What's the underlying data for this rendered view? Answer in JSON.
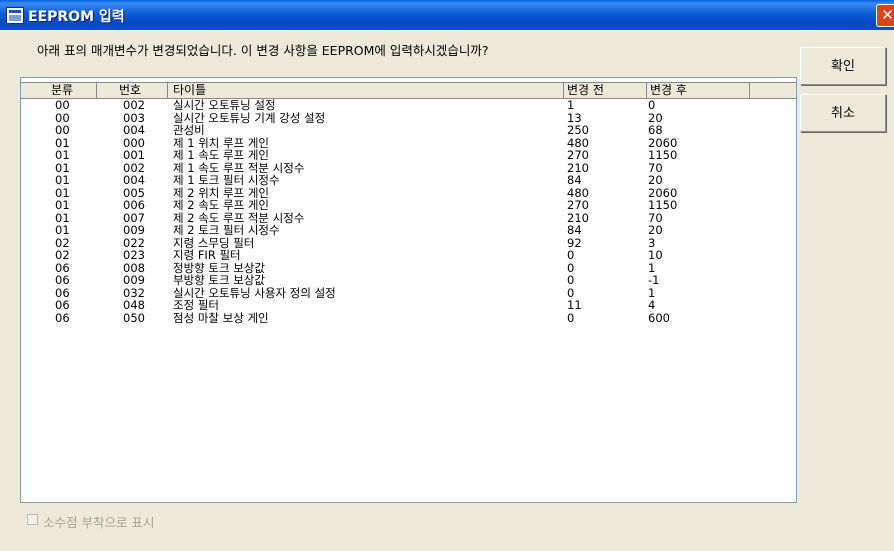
{
  "window": {
    "title": "EEPROM 입력",
    "close": "✕"
  },
  "message": "아래 표의 매개변수가 변경되었습니다. 이 변경 사항을 EEPROM에 입력하시겠습니까?",
  "buttons": {
    "ok": "확인",
    "cancel": "취소"
  },
  "table": {
    "headers": [
      "분류",
      "번호",
      "타이틀",
      "변경 전",
      "변경 후"
    ],
    "rows": [
      [
        "00",
        "002",
        "실시간 오토튜닝 설정",
        "1",
        "0"
      ],
      [
        "00",
        "003",
        "실시간 오토튜닝 기계 강성 설정",
        "13",
        "20"
      ],
      [
        "00",
        "004",
        "관성비",
        "250",
        "68"
      ],
      [
        "01",
        "000",
        "제 1 위치 루프 게인",
        "480",
        "2060"
      ],
      [
        "01",
        "001",
        "제 1 속도 루프 게인",
        "270",
        "1150"
      ],
      [
        "01",
        "002",
        "제 1 속도 루프 적분 시정수",
        "210",
        "70"
      ],
      [
        "01",
        "004",
        "제 1 토크 필터 시정수",
        "84",
        "20"
      ],
      [
        "01",
        "005",
        "제 2 위치 루프 게인",
        "480",
        "2060"
      ],
      [
        "01",
        "006",
        "제 2 속도 루프 게인",
        "270",
        "1150"
      ],
      [
        "01",
        "007",
        "제 2 속도 루프 적분 시정수",
        "210",
        "70"
      ],
      [
        "01",
        "009",
        "제 2 토크 필터 시정수",
        "84",
        "20"
      ],
      [
        "02",
        "022",
        "지령 스무딩 필터",
        "92",
        "3"
      ],
      [
        "02",
        "023",
        "지령 FIR 필터",
        "0",
        "10"
      ],
      [
        "06",
        "008",
        "정방향 토크 보상값",
        "0",
        "1"
      ],
      [
        "06",
        "009",
        "부방향 토크 보상값",
        "0",
        "-1"
      ],
      [
        "06",
        "032",
        "실시간 오토튜닝 사용자 정의 설정",
        "0",
        "1"
      ],
      [
        "06",
        "048",
        "조정 필터",
        "11",
        "4"
      ],
      [
        "06",
        "050",
        "점성 마찰 보상 게인",
        "0",
        "600"
      ]
    ]
  },
  "checkbox": {
    "label": "소수점 부착으로 표시",
    "checked": false
  }
}
